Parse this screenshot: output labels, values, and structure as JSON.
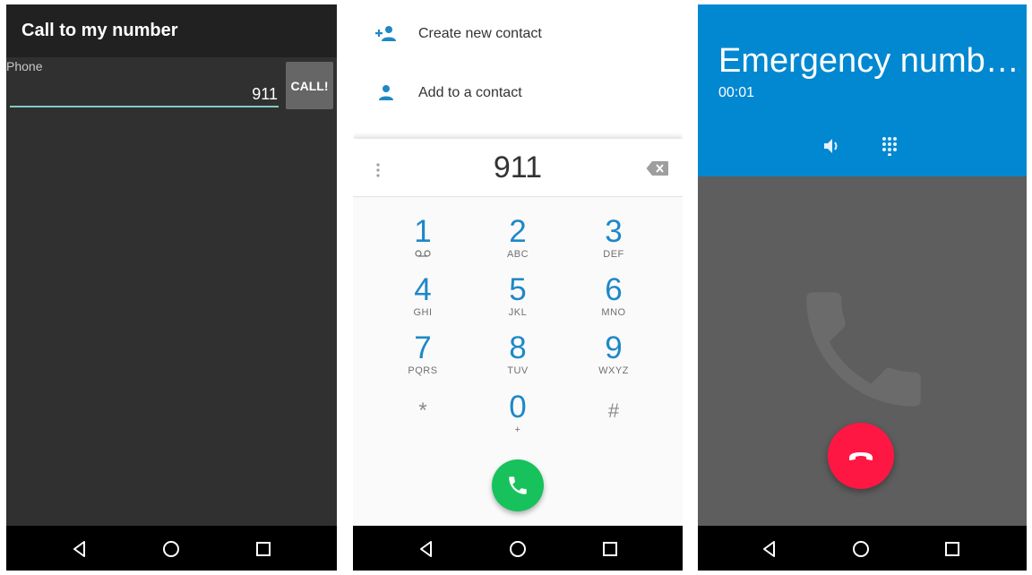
{
  "screen1": {
    "title": "Call to my number",
    "field_label": "Phone",
    "field_value": "911",
    "call_button": "CALL!"
  },
  "screen2": {
    "menu": [
      {
        "label": "Create new contact",
        "icon": "add-person-icon"
      },
      {
        "label": "Add to a contact",
        "icon": "person-icon"
      }
    ],
    "digits": "911",
    "keys": [
      {
        "num": "1",
        "letters": ""
      },
      {
        "num": "2",
        "letters": "ABC"
      },
      {
        "num": "3",
        "letters": "DEF"
      },
      {
        "num": "4",
        "letters": "GHI"
      },
      {
        "num": "5",
        "letters": "JKL"
      },
      {
        "num": "6",
        "letters": "MNO"
      },
      {
        "num": "7",
        "letters": "PQRS"
      },
      {
        "num": "8",
        "letters": "TUV"
      },
      {
        "num": "9",
        "letters": "WXYZ"
      },
      {
        "num": "*",
        "letters": ""
      },
      {
        "num": "0",
        "letters": "+"
      },
      {
        "num": "#",
        "letters": ""
      }
    ],
    "colors": {
      "accent": "#1e88c7",
      "call": "#17c25d"
    }
  },
  "screen3": {
    "contact_name": "Emergency numb…",
    "call_timer": "00:01",
    "colors": {
      "header": "#0288d1",
      "end_call": "#ff1744"
    }
  }
}
